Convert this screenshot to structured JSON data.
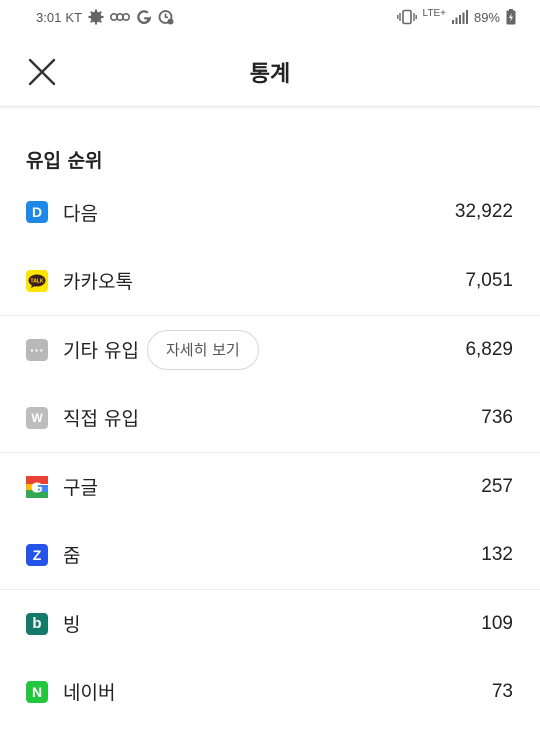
{
  "status_bar": {
    "time": "3:01",
    "carrier": "KT",
    "network": "LTE+",
    "battery": "89%"
  },
  "header": {
    "title": "통계"
  },
  "section": {
    "title": "유입 순위"
  },
  "sources": [
    {
      "name": "다음",
      "count": "32,922",
      "icon_letter": "D",
      "icon": "daum-icon",
      "color": "#1e88e5"
    },
    {
      "name": "카카오톡",
      "count": "7,051",
      "icon_letter": "TALK",
      "icon": "kakaotalk-icon",
      "color": "#fee500"
    },
    {
      "name": "기타 유입",
      "count": "6,829",
      "icon_letter": "···",
      "icon": "more-dots-icon",
      "color": "#b8b8b8",
      "detail_button": "자세히 보기"
    },
    {
      "name": "직접 유입",
      "count": "736",
      "icon_letter": "W",
      "icon": "direct-w-icon",
      "color": "#bdbdbd"
    },
    {
      "name": "구글",
      "count": "257",
      "icon_letter": "G",
      "icon": "google-icon",
      "color": "#ffffff"
    },
    {
      "name": "줌",
      "count": "132",
      "icon_letter": "Z",
      "icon": "zum-icon",
      "color": "#2454e8"
    },
    {
      "name": "빙",
      "count": "109",
      "icon_letter": "b",
      "icon": "bing-icon",
      "color": "#137a6a"
    },
    {
      "name": "네이버",
      "count": "73",
      "icon_letter": "N",
      "icon": "naver-icon",
      "color": "#23c63c"
    }
  ]
}
